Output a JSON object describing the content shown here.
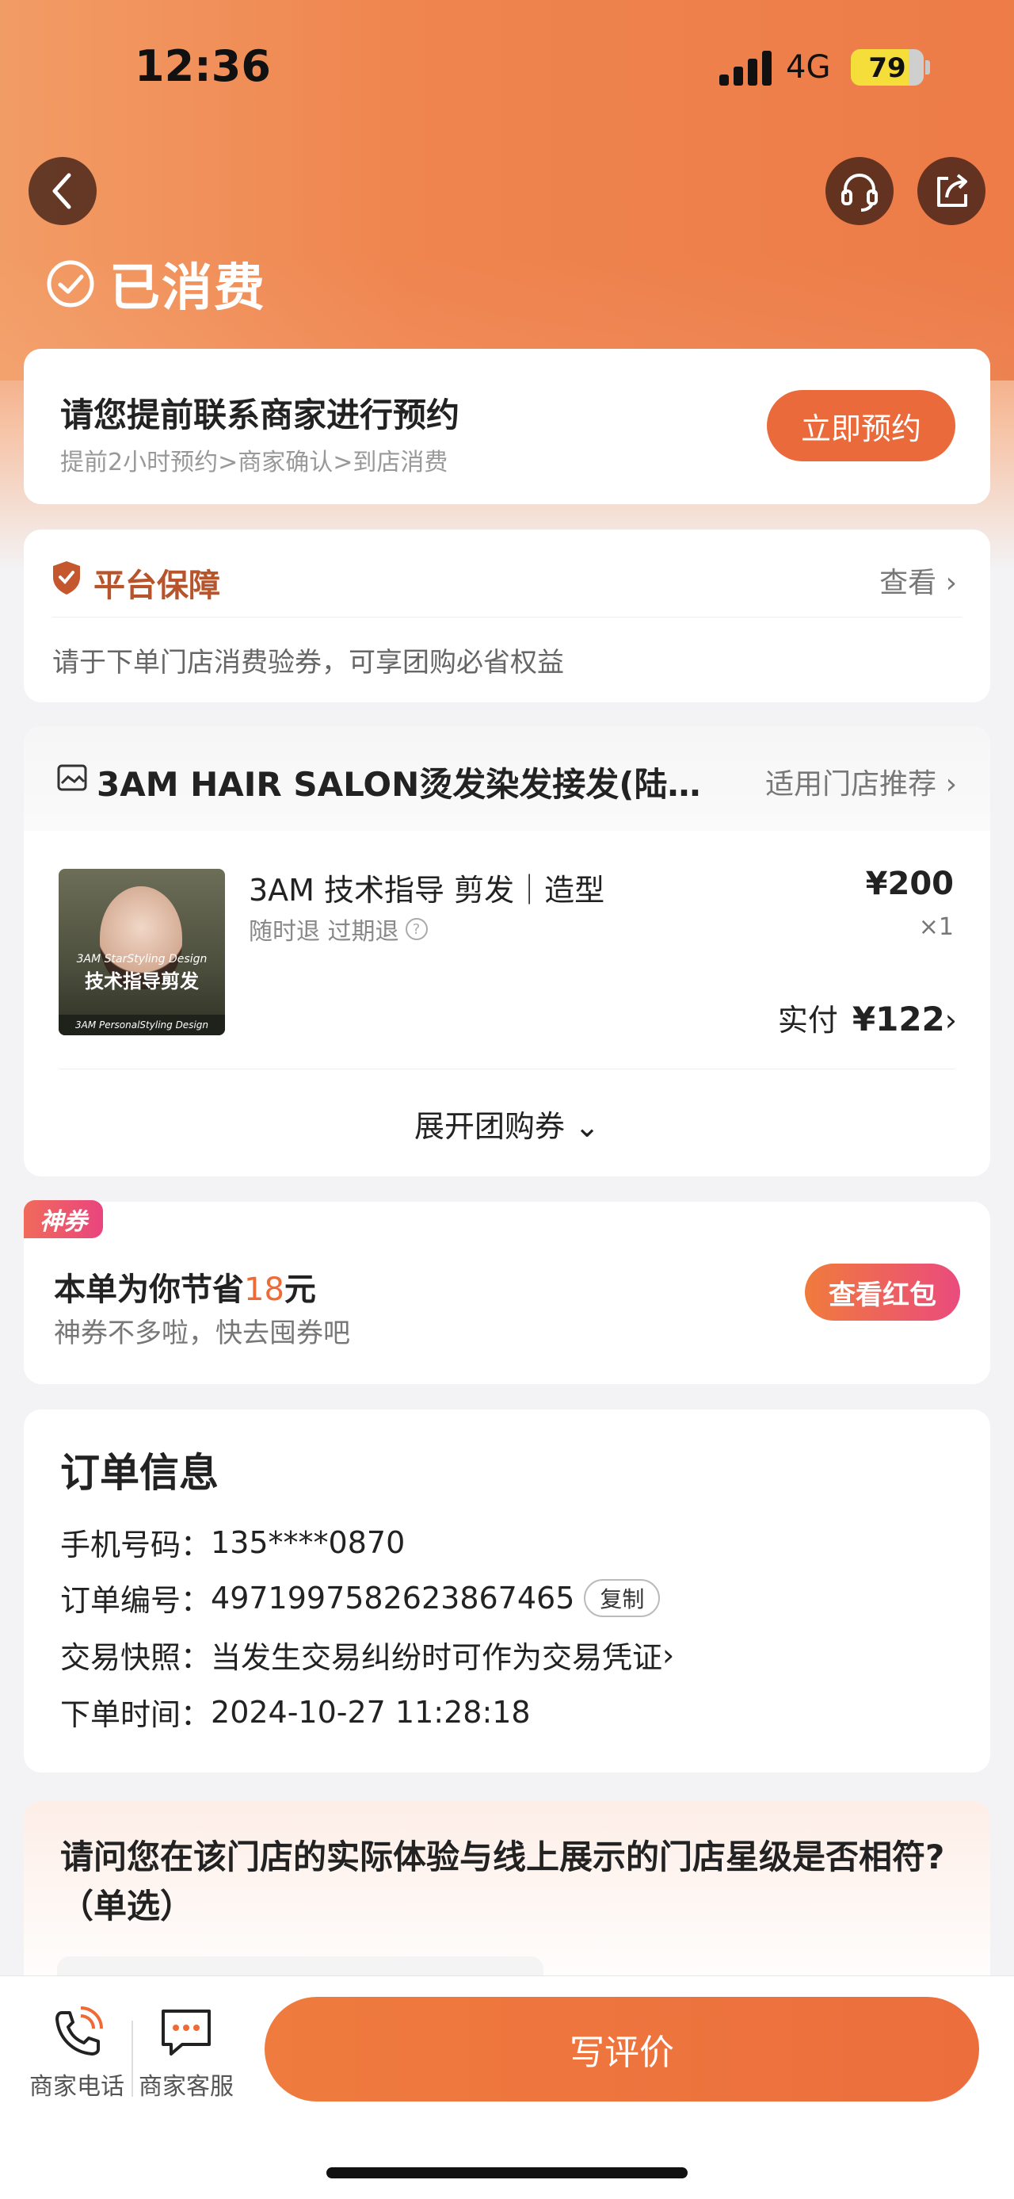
{
  "status_bar": {
    "time": "12:36",
    "network": "4G",
    "battery": "79",
    "battery_level": 0.79
  },
  "header": {
    "status": "已消费"
  },
  "reserve": {
    "title": "请您提前联系商家进行预约",
    "subtitle": "提前2小时预约>商家确认>到店消费",
    "button": "立即预约"
  },
  "guarantee": {
    "title": "平台保障",
    "view": "查看",
    "desc": "请于下单门店消费验券，可享团购必省权益"
  },
  "product": {
    "shop_name": "3AM HAIR SALON烫发染发接发(陆…",
    "shop_recommend": "适用门店推荐",
    "thumb_line1": "3AM StarStyling Design",
    "thumb_line2": "技术指导剪发",
    "thumb_line3": "3AM PersonalStyling Design",
    "name": "3AM 技术指导 剪发｜造型",
    "tags": "随时退  过期退",
    "price": "¥200",
    "qty": "×1",
    "paid_label": "实付",
    "paid_amount": "¥122",
    "expand": "展开团购券"
  },
  "coupon": {
    "badge": "神券",
    "title_prefix": "本单为你节省",
    "saved": "18",
    "title_suffix": "元",
    "subtitle": "神券不多啦，快去囤券吧",
    "button": "查看红包"
  },
  "order": {
    "title": "订单信息",
    "phone_label": "手机号码：",
    "phone": "135****0870",
    "no_label": "订单编号：",
    "no": "4971997582623867465",
    "copy": "复制",
    "snapshot_label": "交易快照：",
    "snapshot": "当发生交易纠纷时可作为交易凭证",
    "time_label": "下单时间：",
    "time": "2024-10-27 11:28:18"
  },
  "survey": {
    "question": "请问您在该门店的实际体验与线上展示的门店星级是否相符?（单选）"
  },
  "bottom": {
    "phone": "商家电话",
    "cs": "商家客服",
    "review": "写评价"
  },
  "colors": {
    "accent": "#ea6a3b",
    "guarantee": "#b8542b",
    "highlight": "#ef6b35"
  }
}
